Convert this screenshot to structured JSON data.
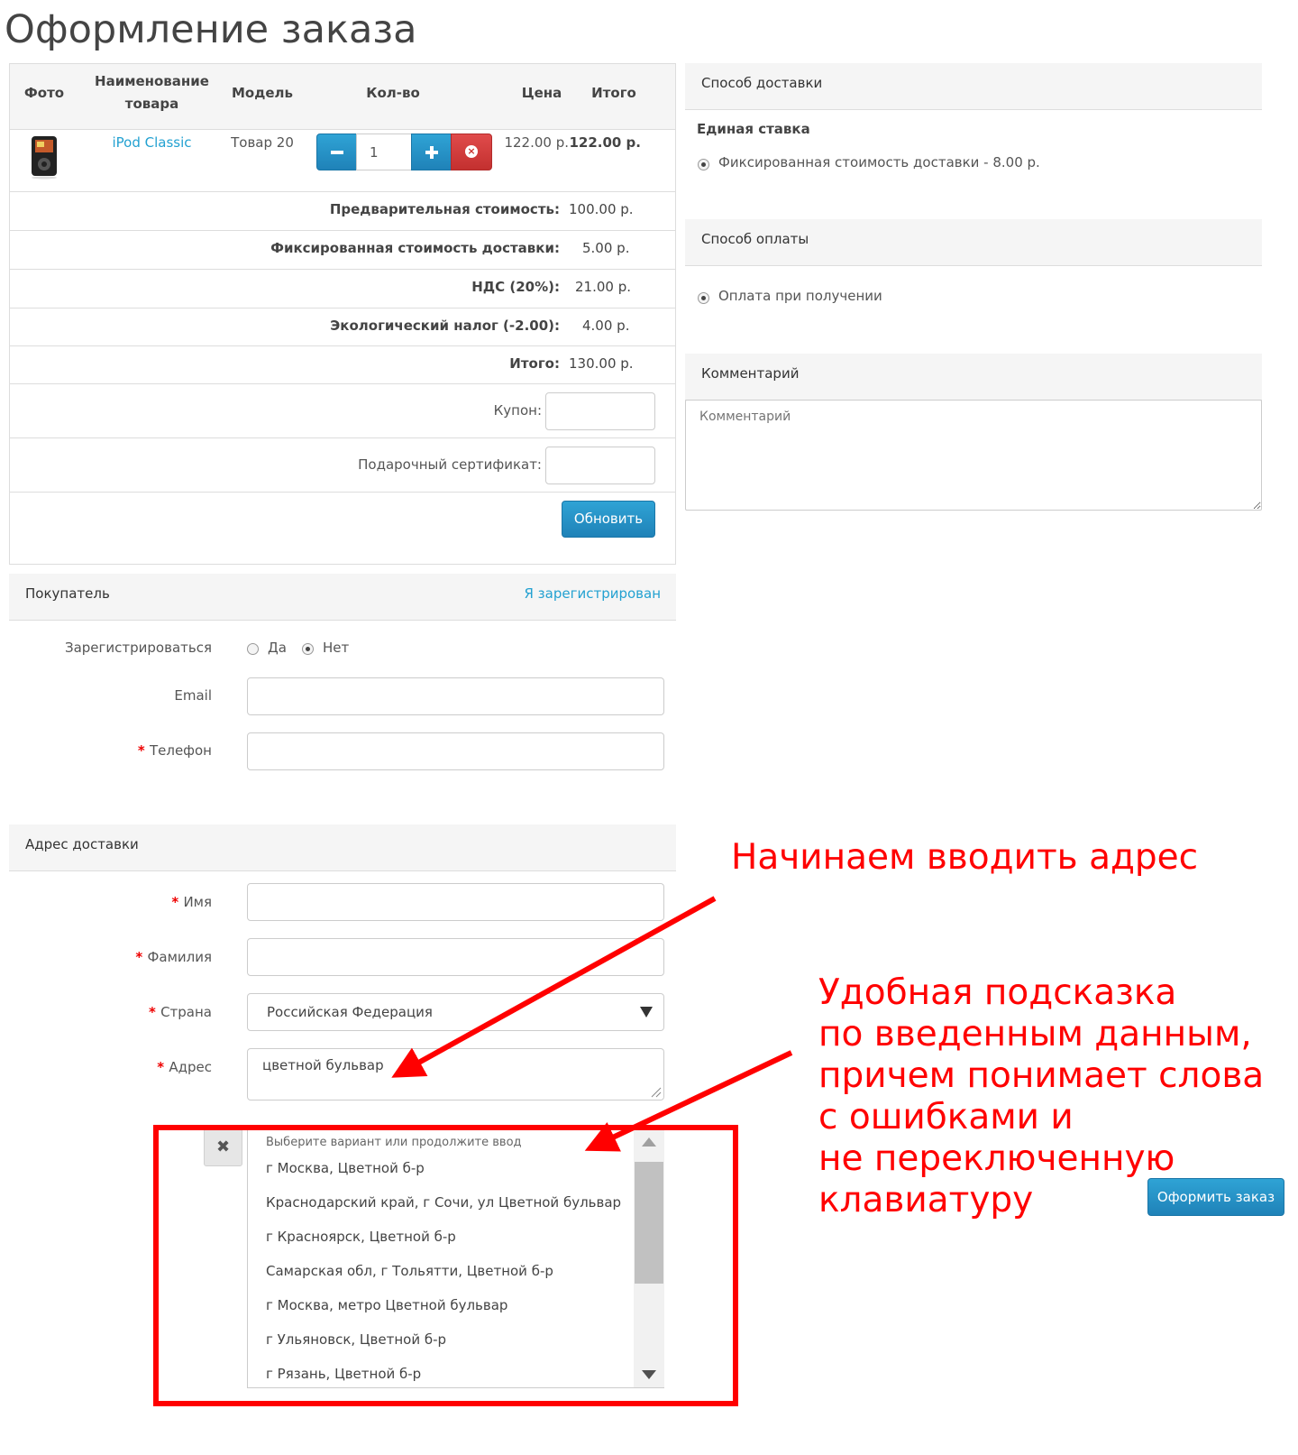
{
  "page": {
    "title": "Оформление заказа"
  },
  "cart": {
    "headers": {
      "photo": "Фото",
      "name_line1": "Наименование",
      "name_line2": "товара",
      "model": "Модель",
      "qty": "Кол-во",
      "price": "Цена",
      "total": "Итого"
    },
    "item": {
      "name": "iPod Classic",
      "model": "Товар 20",
      "qty": "1",
      "price": "122.00 р.",
      "total": "122.00 р."
    },
    "totals": [
      {
        "label": "Предварительная стоимость:",
        "value": "100.00 р."
      },
      {
        "label": "Фиксированная стоимость доставки:",
        "value": "5.00 р."
      },
      {
        "label": "НДС (20%):",
        "value": "21.00 р."
      },
      {
        "label": "Экологический налог (-2.00):",
        "value": "4.00 р."
      },
      {
        "label": "Итого:",
        "value": "130.00 р."
      }
    ],
    "coupon_label": "Купон:",
    "voucher_label": "Подарочный сертификат:",
    "update_button": "Обновить"
  },
  "shipping": {
    "title": "Способ доставки",
    "group": "Единая ставка",
    "option": "Фиксированная стоимость доставки - 8.00 р."
  },
  "payment": {
    "title": "Способ оплаты",
    "option": "Оплата при получении"
  },
  "comment": {
    "title": "Комментарий",
    "placeholder": "Комментарий"
  },
  "customer": {
    "title": "Покупатель",
    "login_link": "Я зарегистрирован",
    "register_label": "Зарегистрироваться",
    "yes": "Да",
    "no": "Нет",
    "email_label": "Email",
    "phone_label": "Телефон"
  },
  "address": {
    "title": "Адрес доставки",
    "firstname_label": "Имя",
    "lastname_label": "Фамилия",
    "country_label": "Страна",
    "country_value": "Российская Федерация",
    "address_label": "Адрес",
    "address_value": "цветной бульвар"
  },
  "suggestions": {
    "hint": "Выберите вариант или продолжите ввод",
    "items": [
      "г Москва, Цветной б-р",
      "Краснодарский край, г Сочи, ул Цветной бульвар",
      "г Красноярск, Цветной б-р",
      "Самарская обл, г Тольятти, Цветной б-р",
      "г Москва, метро Цветной бульвар",
      "г Ульяновск, Цветной б-р",
      "г Рязань, Цветной б-р"
    ]
  },
  "checkout_button": "Оформить заказ",
  "annotations": {
    "top": "Начинаем вводить адрес",
    "lines": [
      "Удобная подсказка",
      "по введенным данным,",
      "причем понимает слова",
      "с ошибками и",
      "не переключенную",
      "клавиатуру"
    ]
  },
  "colors": {
    "accent": "#23a1d1",
    "annotation": "#ff0000",
    "danger": "#c9302c"
  }
}
